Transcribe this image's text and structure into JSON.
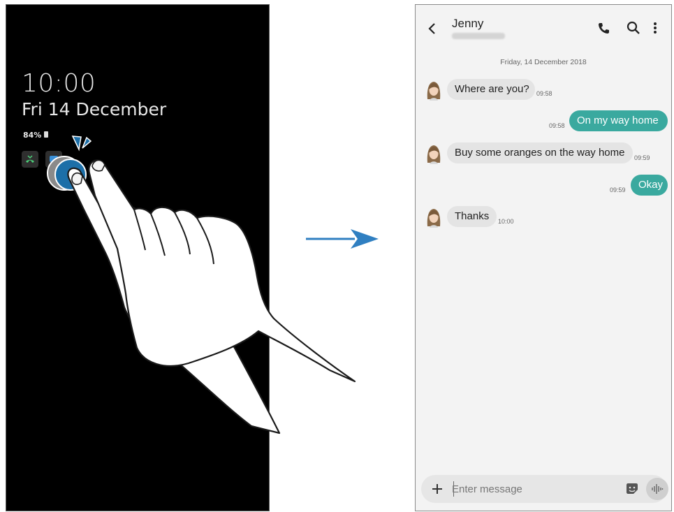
{
  "aod": {
    "time": "10:00",
    "date": "Fri 14 December",
    "battery": "84%",
    "icons": [
      "missed-call-icon",
      "message-icon"
    ]
  },
  "chat": {
    "contact_name": "Jenny",
    "header_icons": [
      "back-icon",
      "phone-icon",
      "search-icon",
      "more-icon"
    ],
    "date_separator": "Friday, 14 December 2018",
    "messages": [
      {
        "direction": "in",
        "text": "Where are you?",
        "time": "09:58"
      },
      {
        "direction": "out",
        "text": "On my way home",
        "time": "09:58"
      },
      {
        "direction": "in",
        "text": "Buy some oranges on the way home",
        "time": "09:59"
      },
      {
        "direction": "out",
        "text": "Okay",
        "time": "09:59"
      },
      {
        "direction": "in",
        "text": "Thanks",
        "time": "10:00"
      }
    ],
    "composer": {
      "placeholder": "Enter message",
      "icons": [
        "plus-icon",
        "sticker-icon",
        "voice-icon"
      ]
    }
  },
  "colors": {
    "outgoing_bubble": "#3aa99f",
    "incoming_bubble": "#e4e4e4",
    "tap_circle": "#1c6fa8",
    "arrow": "#2f7fc1"
  }
}
